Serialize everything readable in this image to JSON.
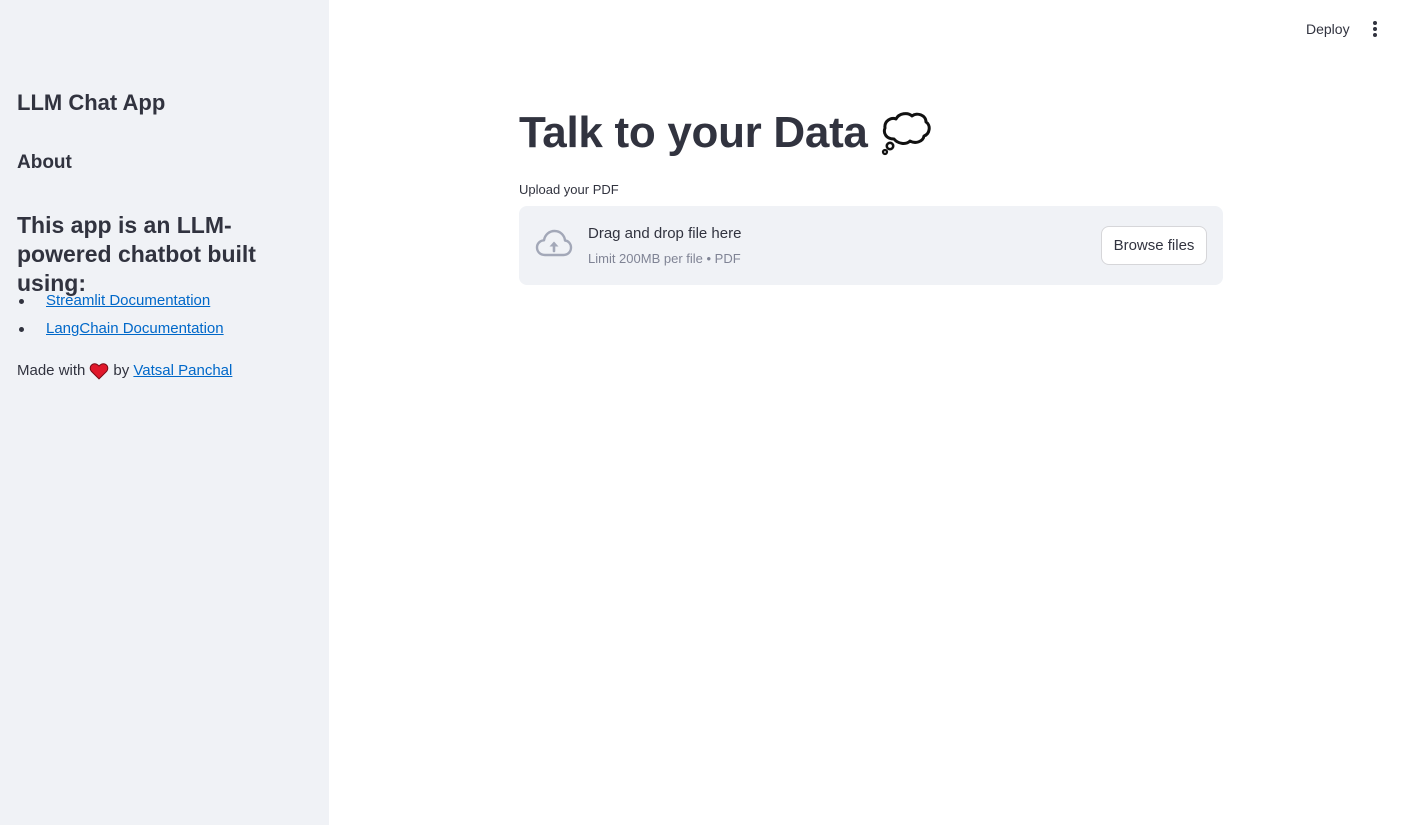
{
  "sidebar": {
    "title": "LLM Chat App",
    "about_heading": "About",
    "description": "This app is an LLM-powered chatbot built using:",
    "links": [
      {
        "label": "Streamlit Documentation"
      },
      {
        "label": "LangChain Documentation"
      }
    ],
    "made_with_prefix": "Made with",
    "made_with_icon": "heart-icon",
    "made_with_by": "by",
    "author_label": "Vatsal Panchal"
  },
  "header": {
    "deploy_label": "Deploy",
    "menu_icon": "vertical-dots-icon"
  },
  "main": {
    "title": "Talk to your Data",
    "title_icon": "thought-balloon-icon",
    "uploader": {
      "label": "Upload your PDF",
      "drop_text": "Drag and drop file here",
      "limit_text": "Limit 200MB per file • PDF",
      "button_label": "Browse files",
      "icon": "cloud-upload-icon"
    }
  },
  "colors": {
    "sidebar_bg": "#f0f2f6",
    "text": "#31333f",
    "link": "#0068c9",
    "muted": "#808495",
    "heart": "#e0182b"
  }
}
